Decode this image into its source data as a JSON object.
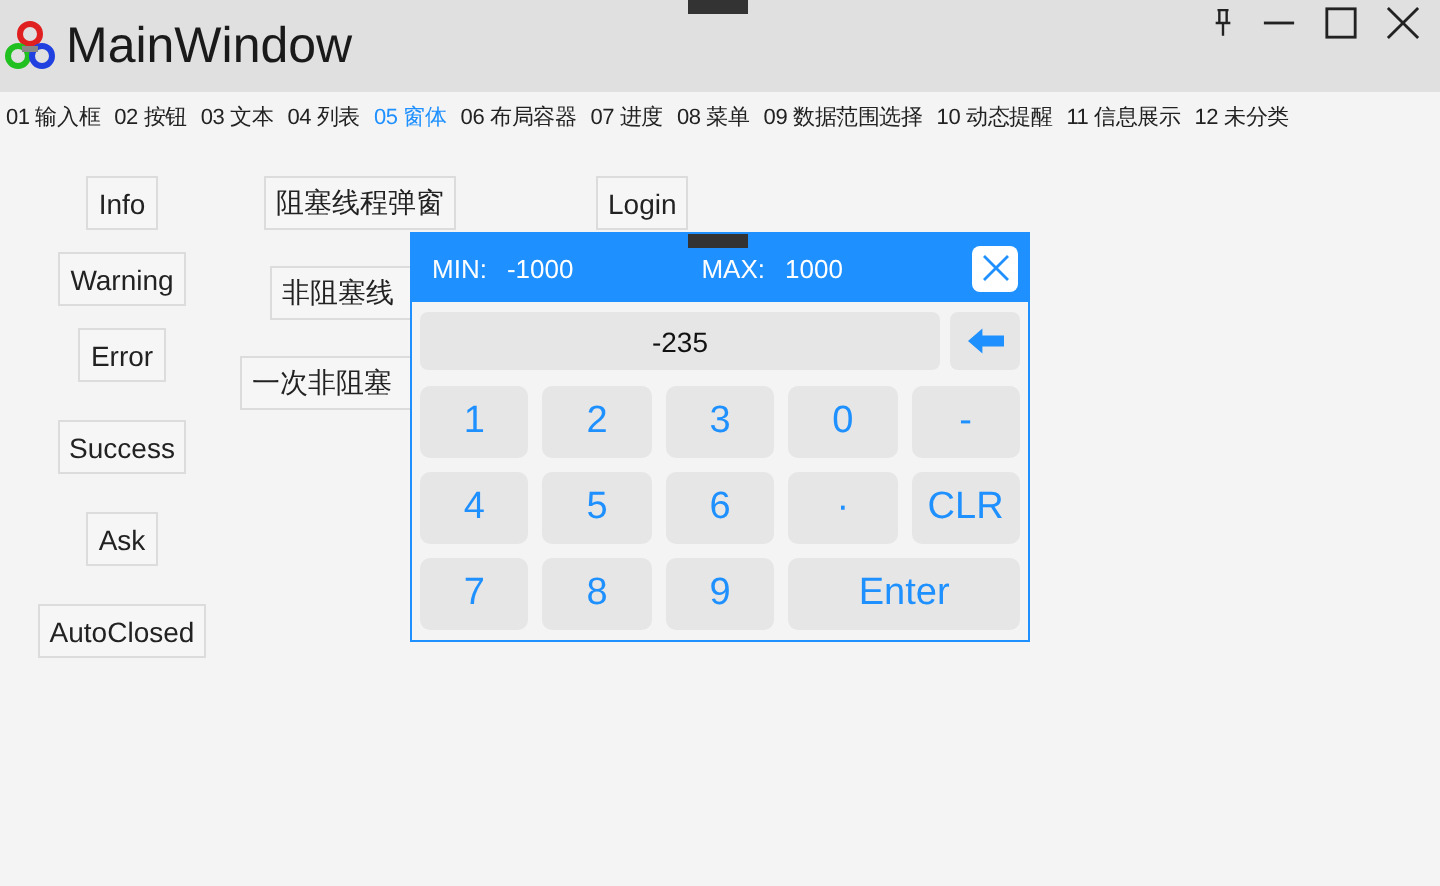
{
  "window": {
    "title": "MainWindow"
  },
  "tabs": [
    {
      "label": "01 输入框",
      "selected": false
    },
    {
      "label": "02 按钮",
      "selected": false
    },
    {
      "label": "03 文本",
      "selected": false
    },
    {
      "label": "04 列表",
      "selected": false
    },
    {
      "label": "05 窗体",
      "selected": true
    },
    {
      "label": "06 布局容器",
      "selected": false
    },
    {
      "label": "07 进度",
      "selected": false
    },
    {
      "label": "08 菜单",
      "selected": false
    },
    {
      "label": "09 数据范围选择",
      "selected": false
    },
    {
      "label": "10 动态提醒",
      "selected": false
    },
    {
      "label": "11 信息展示",
      "selected": false
    },
    {
      "label": "12 未分类",
      "selected": false
    }
  ],
  "message_buttons": [
    "Info",
    "Warning",
    "Error",
    "Success",
    "Ask",
    "AutoClosed"
  ],
  "thread_buttons": [
    "阻塞线程弹窗",
    "非阻塞线",
    "一次非阻塞"
  ],
  "login_button": "Login",
  "keypad": {
    "min_label": "MIN:",
    "min": "-1000",
    "max_label": "MAX:",
    "max": "1000",
    "value": "-235",
    "keys": [
      {
        "label": "1",
        "kind": "normal"
      },
      {
        "label": "2",
        "kind": "normal"
      },
      {
        "label": "3",
        "kind": "normal"
      },
      {
        "label": "0",
        "kind": "normal"
      },
      {
        "label": "-",
        "kind": "normal"
      },
      {
        "label": "4",
        "kind": "normal"
      },
      {
        "label": "5",
        "kind": "normal"
      },
      {
        "label": "6",
        "kind": "normal"
      },
      {
        "label": "·",
        "kind": "normal"
      },
      {
        "label": "CLR",
        "kind": "normal"
      },
      {
        "label": "7",
        "kind": "normal"
      },
      {
        "label": "8",
        "kind": "normal"
      },
      {
        "label": "9",
        "kind": "normal"
      },
      {
        "label": "Enter",
        "kind": "wide"
      }
    ]
  }
}
